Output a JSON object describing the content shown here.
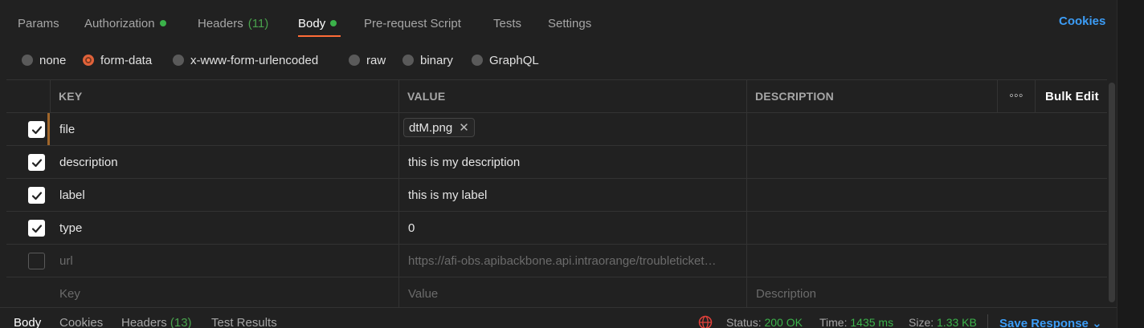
{
  "request_tabs": [
    {
      "label": "Params"
    },
    {
      "label": "Authorization"
    },
    {
      "label": "Headers",
      "count": "(11)"
    },
    {
      "label": "Body"
    },
    {
      "label": "Pre-request Script"
    },
    {
      "label": "Tests"
    },
    {
      "label": "Settings"
    }
  ],
  "cookies_label": "Cookies",
  "body_types": [
    "none",
    "form-data",
    "x-www-form-urlencoded",
    "raw",
    "binary",
    "GraphQL"
  ],
  "selected_body_type": "form-data",
  "table": {
    "headers": {
      "key": "KEY",
      "value": "VALUE",
      "description": "DESCRIPTION",
      "more": "◦◦◦",
      "bulk_edit": "Bulk Edit"
    },
    "rows": [
      {
        "key": "file",
        "value": "dtM.png",
        "checked": true,
        "type": "file"
      },
      {
        "key": "description",
        "value": "this is my description",
        "checked": true
      },
      {
        "key": "label",
        "value": "this is my label",
        "checked": true
      },
      {
        "key": "type",
        "value": "0",
        "checked": true
      },
      {
        "key": "url",
        "value": "https://afi-obs.apibackbone.api.intraorange/troubleticket…",
        "checked": false
      }
    ],
    "placeholders": {
      "key": "Key",
      "value": "Value",
      "description": "Description"
    }
  },
  "response": {
    "tabs": [
      {
        "label": "Body"
      },
      {
        "label": "Cookies"
      },
      {
        "label": "Headers",
        "count": "(13)"
      },
      {
        "label": "Test Results"
      }
    ],
    "status_label": "Status:",
    "status_value": "200 OK",
    "time_label": "Time:",
    "time_value": "1435 ms",
    "size_label": "Size:",
    "size_value": "1.33 KB",
    "save_label": "Save Response",
    "save_chevron": "⌄"
  },
  "colors": {
    "accent": "#ff6c37",
    "link": "#3c9df7",
    "success": "#3bb24a"
  }
}
